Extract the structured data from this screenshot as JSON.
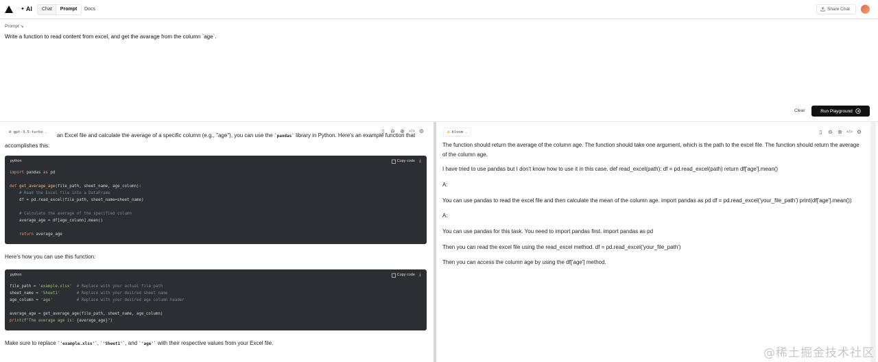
{
  "nav": {
    "brand": "AI",
    "tabs": [
      "Chat",
      "Prompt"
    ],
    "docs": "Docs",
    "share_label": "Share Chat"
  },
  "prompt": {
    "label": "Prompt",
    "text": "Write a function to read content from excel, and get the avarage from the column `age`."
  },
  "actions": {
    "clear": "Clear",
    "run": "Run Playground"
  },
  "left": {
    "model": "gpt-3.5-turbo",
    "intro_a": "an Excel file and calculate the average of a specific column (e.g., \"age\"), you can use the ",
    "intro_code": "`pandas`",
    "intro_b": " library in Python. Here's an example function that accomplishes this:",
    "code1": {
      "lang": "python",
      "copy": "Copy code"
    },
    "middle_text": "Here's how you can use this function:",
    "code2": {
      "lang": "python",
      "copy": "Copy code"
    },
    "final_a": "Make sure to replace ",
    "final_c1": "`'example.xlsx'`",
    "final_sep1": ", ",
    "final_c2": "`'Sheet1'`",
    "final_sep2": ", and ",
    "final_c3": "`'age'`",
    "final_b": " with their respective values from your Excel file."
  },
  "right": {
    "model": "bloom",
    "paragraphs": [
      "The function should return the average of the column age. The function should take one argument, which is the path to the excel file. The function should return the average of the column age.",
      "I have tried to use pandas but I don't know how to use it in this case. def read_excel(path): df = pd.read_excel(path) return df['age'].mean()",
      "A:",
      "You can use pandas to read the excel file and then calculate the mean of the column age. import pandas as pd df = pd.read_excel('your_file_path') print(df['age'].mean())",
      "A:",
      "You can use pandas for this task. You need to import pandas first. import pandas as pd",
      "Then you can read the excel file using the read_excel method. df = pd.read_excel('your_file_path')",
      "Then you can access the column age by using the df['age'] method."
    ]
  },
  "watermark": "@稀土掘金技术社区"
}
